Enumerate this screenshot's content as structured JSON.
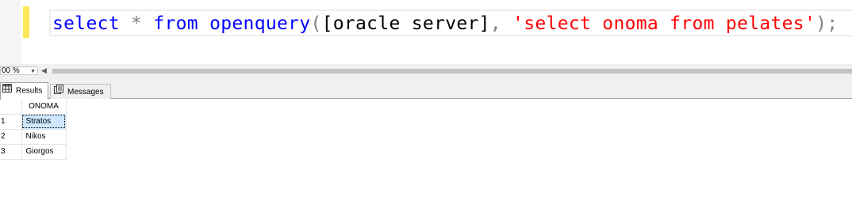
{
  "editor": {
    "tokens": [
      {
        "text": "select",
        "cls": "kw"
      },
      {
        "text": " ",
        "cls": "plain"
      },
      {
        "text": "*",
        "cls": "op"
      },
      {
        "text": " ",
        "cls": "plain"
      },
      {
        "text": "from",
        "cls": "kw"
      },
      {
        "text": " ",
        "cls": "plain"
      },
      {
        "text": "openquery",
        "cls": "kw"
      },
      {
        "text": "(",
        "cls": "op"
      },
      {
        "text": "[oracle server]",
        "cls": "plain"
      },
      {
        "text": ",",
        "cls": "op"
      },
      {
        "text": " ",
        "cls": "plain"
      },
      {
        "text": "'select onoma from pelates'",
        "cls": "str"
      },
      {
        "text": ");",
        "cls": "op"
      }
    ]
  },
  "zoom": {
    "value": "00 %"
  },
  "tabs": {
    "results_label": "Results",
    "messages_label": "Messages"
  },
  "grid": {
    "columns": [
      "ONOMA"
    ],
    "rows": [
      {
        "num": "1",
        "values": [
          "Stratos"
        ],
        "selected": true
      },
      {
        "num": "2",
        "values": [
          "Nikos"
        ],
        "selected": false
      },
      {
        "num": "3",
        "values": [
          "Giorgos"
        ],
        "selected": false
      }
    ]
  }
}
